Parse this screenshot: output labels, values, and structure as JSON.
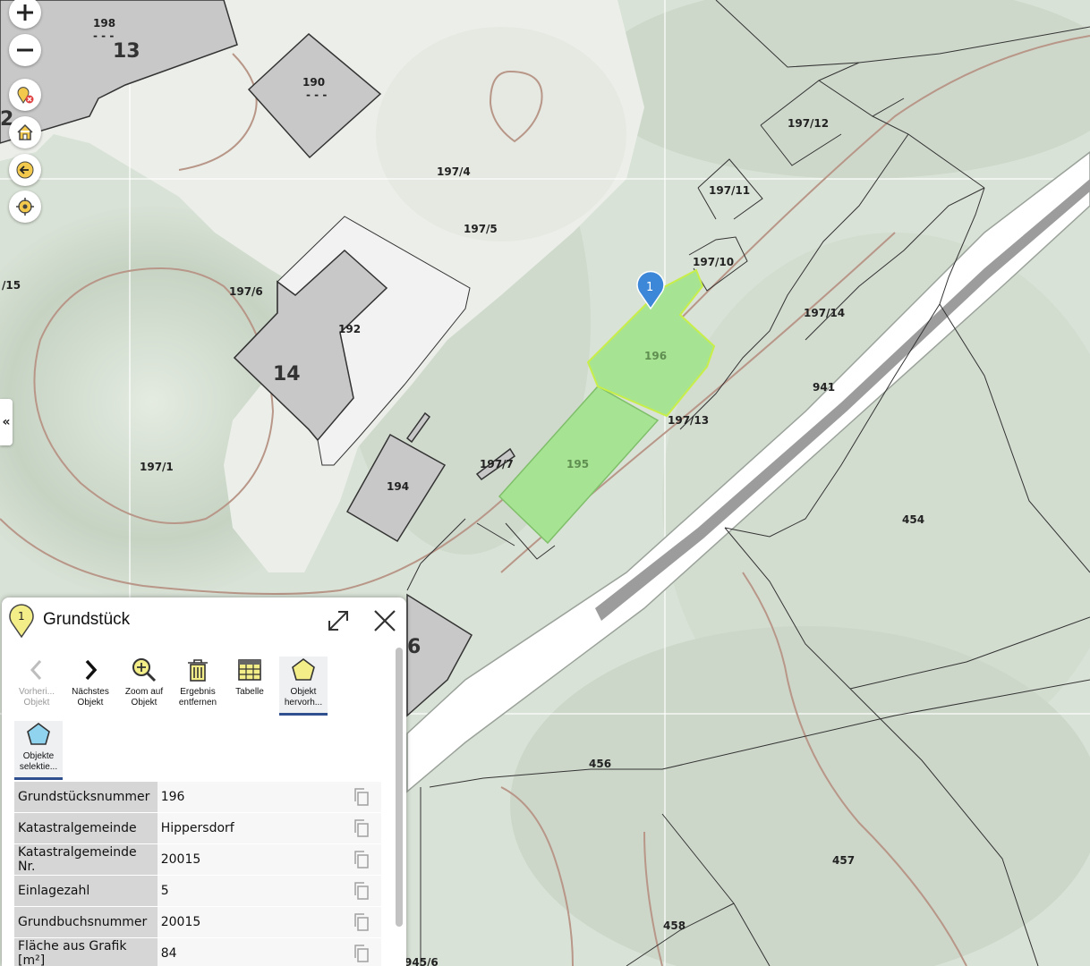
{
  "map": {
    "parcel_labels": [
      "198",
      "- - -",
      "13",
      "190",
      "- - -",
      "197/4",
      "197/5",
      "197/12",
      "197/11",
      "197/10",
      "197/14",
      "/15",
      "197/6",
      "192",
      "14",
      "196",
      "197/13",
      "941",
      "197/1",
      "197/7",
      "195",
      "194",
      "454",
      "6",
      "456",
      "457",
      "458",
      "945/6",
      "2"
    ],
    "marker_number": "1",
    "highlight_color": "#a6e393",
    "controls": [
      {
        "icon": "zoom-in-icon"
      },
      {
        "icon": "zoom-out-icon"
      },
      {
        "icon": "remove-marker-icon"
      },
      {
        "icon": "home-icon"
      },
      {
        "icon": "back-arrow-icon"
      },
      {
        "icon": "locate-icon"
      }
    ],
    "collapse_label": "«"
  },
  "panel": {
    "pin_number": "1",
    "title": "Grundstück",
    "tools": [
      {
        "label_1": "Vorheri...",
        "label_2": "Objekt",
        "icon": "chevron-left-icon",
        "state": "disabled"
      },
      {
        "label_1": "Nächstes",
        "label_2": "Objekt",
        "icon": "chevron-right-icon",
        "state": "normal"
      },
      {
        "label_1": "Zoom auf",
        "label_2": "Objekt",
        "icon": "zoom-to-object-icon",
        "state": "normal"
      },
      {
        "label_1": "Ergebnis",
        "label_2": "entfernen",
        "icon": "trash-icon",
        "state": "normal"
      },
      {
        "label_1": "Tabelle",
        "label_2": "",
        "icon": "table-icon",
        "state": "normal"
      },
      {
        "label_1": "Objekt",
        "label_2": "hervorh...",
        "icon": "highlight-polygon-icon",
        "state": "active"
      },
      {
        "label_1": "Objekte",
        "label_2": "selektie...",
        "icon": "select-polygon-icon",
        "state": "active"
      }
    ],
    "attributes": [
      {
        "key": "Grundstücksnummer",
        "value": "196"
      },
      {
        "key": "Katastralgemeinde",
        "value": "Hippersdorf"
      },
      {
        "key": "Katastralgemeinde Nr.",
        "value": "20015"
      },
      {
        "key": "Einlagezahl",
        "value": "5"
      },
      {
        "key": "Grundbuchsnummer",
        "value": "20015"
      },
      {
        "key": "Fläche aus Grafik [m²]",
        "value": "84"
      }
    ]
  }
}
